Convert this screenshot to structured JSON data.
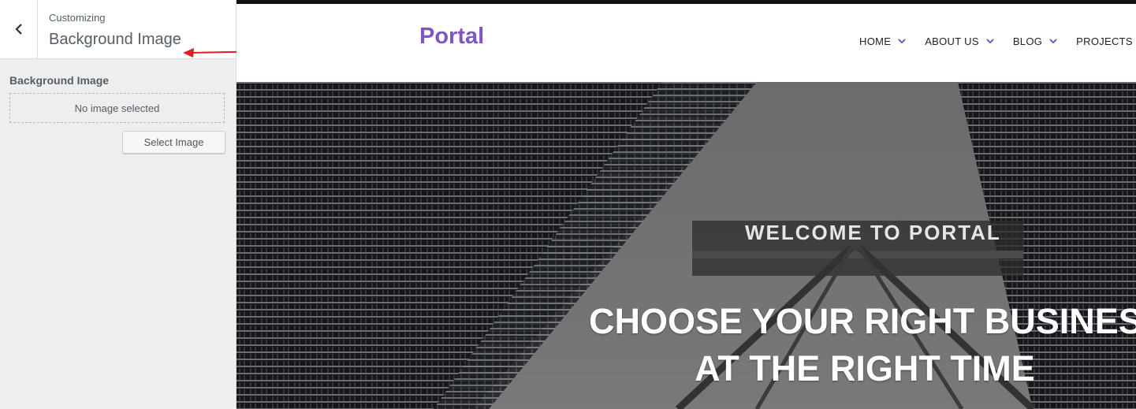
{
  "customizer": {
    "kicker": "Customizing",
    "section_title": "Background Image",
    "control_label": "Background Image",
    "placeholder_text": "No image selected",
    "select_button": "Select Image"
  },
  "site": {
    "logo": "Portal",
    "brand_color": "#7e57c2",
    "nav": [
      "HOME",
      "ABOUT US",
      "BLOG",
      "PROJECTS"
    ]
  },
  "hero": {
    "welcome": "WELCOME TO PORTAL",
    "headline_line1": "CHOOSE YOUR RIGHT BUSINESS",
    "headline_line2": "AT THE RIGHT TIME"
  },
  "annotation_color": "#e0201c"
}
